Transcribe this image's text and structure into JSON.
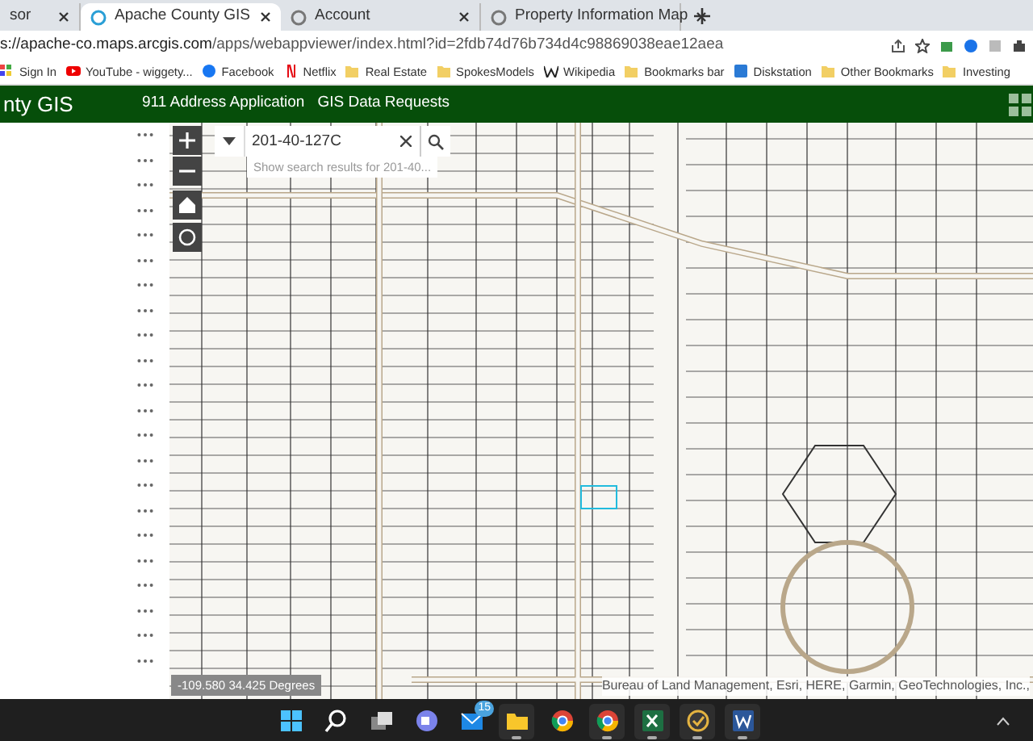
{
  "browser": {
    "tabs": [
      {
        "title": "sor",
        "selected": false
      },
      {
        "title": "Apache County GIS",
        "selected": true
      },
      {
        "title": "Account",
        "selected": false
      },
      {
        "title": "Property Information Map",
        "selected": false
      }
    ],
    "url": {
      "host": "s://apache-co.maps.arcgis.com",
      "path": "/apps/webappviewer/index.html?id=2fdb74d76b734d4c98869038eae12aea"
    },
    "bookmarks": [
      {
        "label": "Sign In",
        "kind": "apps"
      },
      {
        "label": "YouTube - wiggety...",
        "kind": "youtube"
      },
      {
        "label": "Facebook",
        "kind": "facebook"
      },
      {
        "label": "Netflix",
        "kind": "netflix"
      },
      {
        "label": "Real Estate",
        "kind": "folder"
      },
      {
        "label": "SpokesModels",
        "kind": "folder"
      },
      {
        "label": "Wikipedia",
        "kind": "wiki"
      },
      {
        "label": "Bookmarks bar",
        "kind": "folder"
      },
      {
        "label": "Diskstation",
        "kind": "nas"
      },
      {
        "label": "Other Bookmarks",
        "kind": "folder"
      },
      {
        "label": "Investing",
        "kind": "folder"
      }
    ]
  },
  "app": {
    "title": "nty GIS",
    "links": [
      "911 Address Application",
      "GIS Data Requests"
    ]
  },
  "search": {
    "value": "201-40-127C",
    "suggestion": "Show search results for 201-40..."
  },
  "coordinates": "-109.580 34.425 Degrees",
  "attribution": "Bureau of Land Management, Esri, HERE, Garmin, GeoTechnologies, Inc.,",
  "taskbar": {
    "apps": [
      {
        "kind": "start",
        "active": false
      },
      {
        "kind": "search",
        "active": false
      },
      {
        "kind": "taskview",
        "active": false
      },
      {
        "kind": "teams",
        "active": false
      },
      {
        "kind": "mail",
        "active": false,
        "badge": "15"
      },
      {
        "kind": "explorer",
        "active": true
      },
      {
        "kind": "chrome",
        "active": false
      },
      {
        "kind": "chrome",
        "active": true
      },
      {
        "kind": "excel",
        "active": true
      },
      {
        "kind": "tasks",
        "active": true
      },
      {
        "kind": "word",
        "active": true
      }
    ]
  }
}
